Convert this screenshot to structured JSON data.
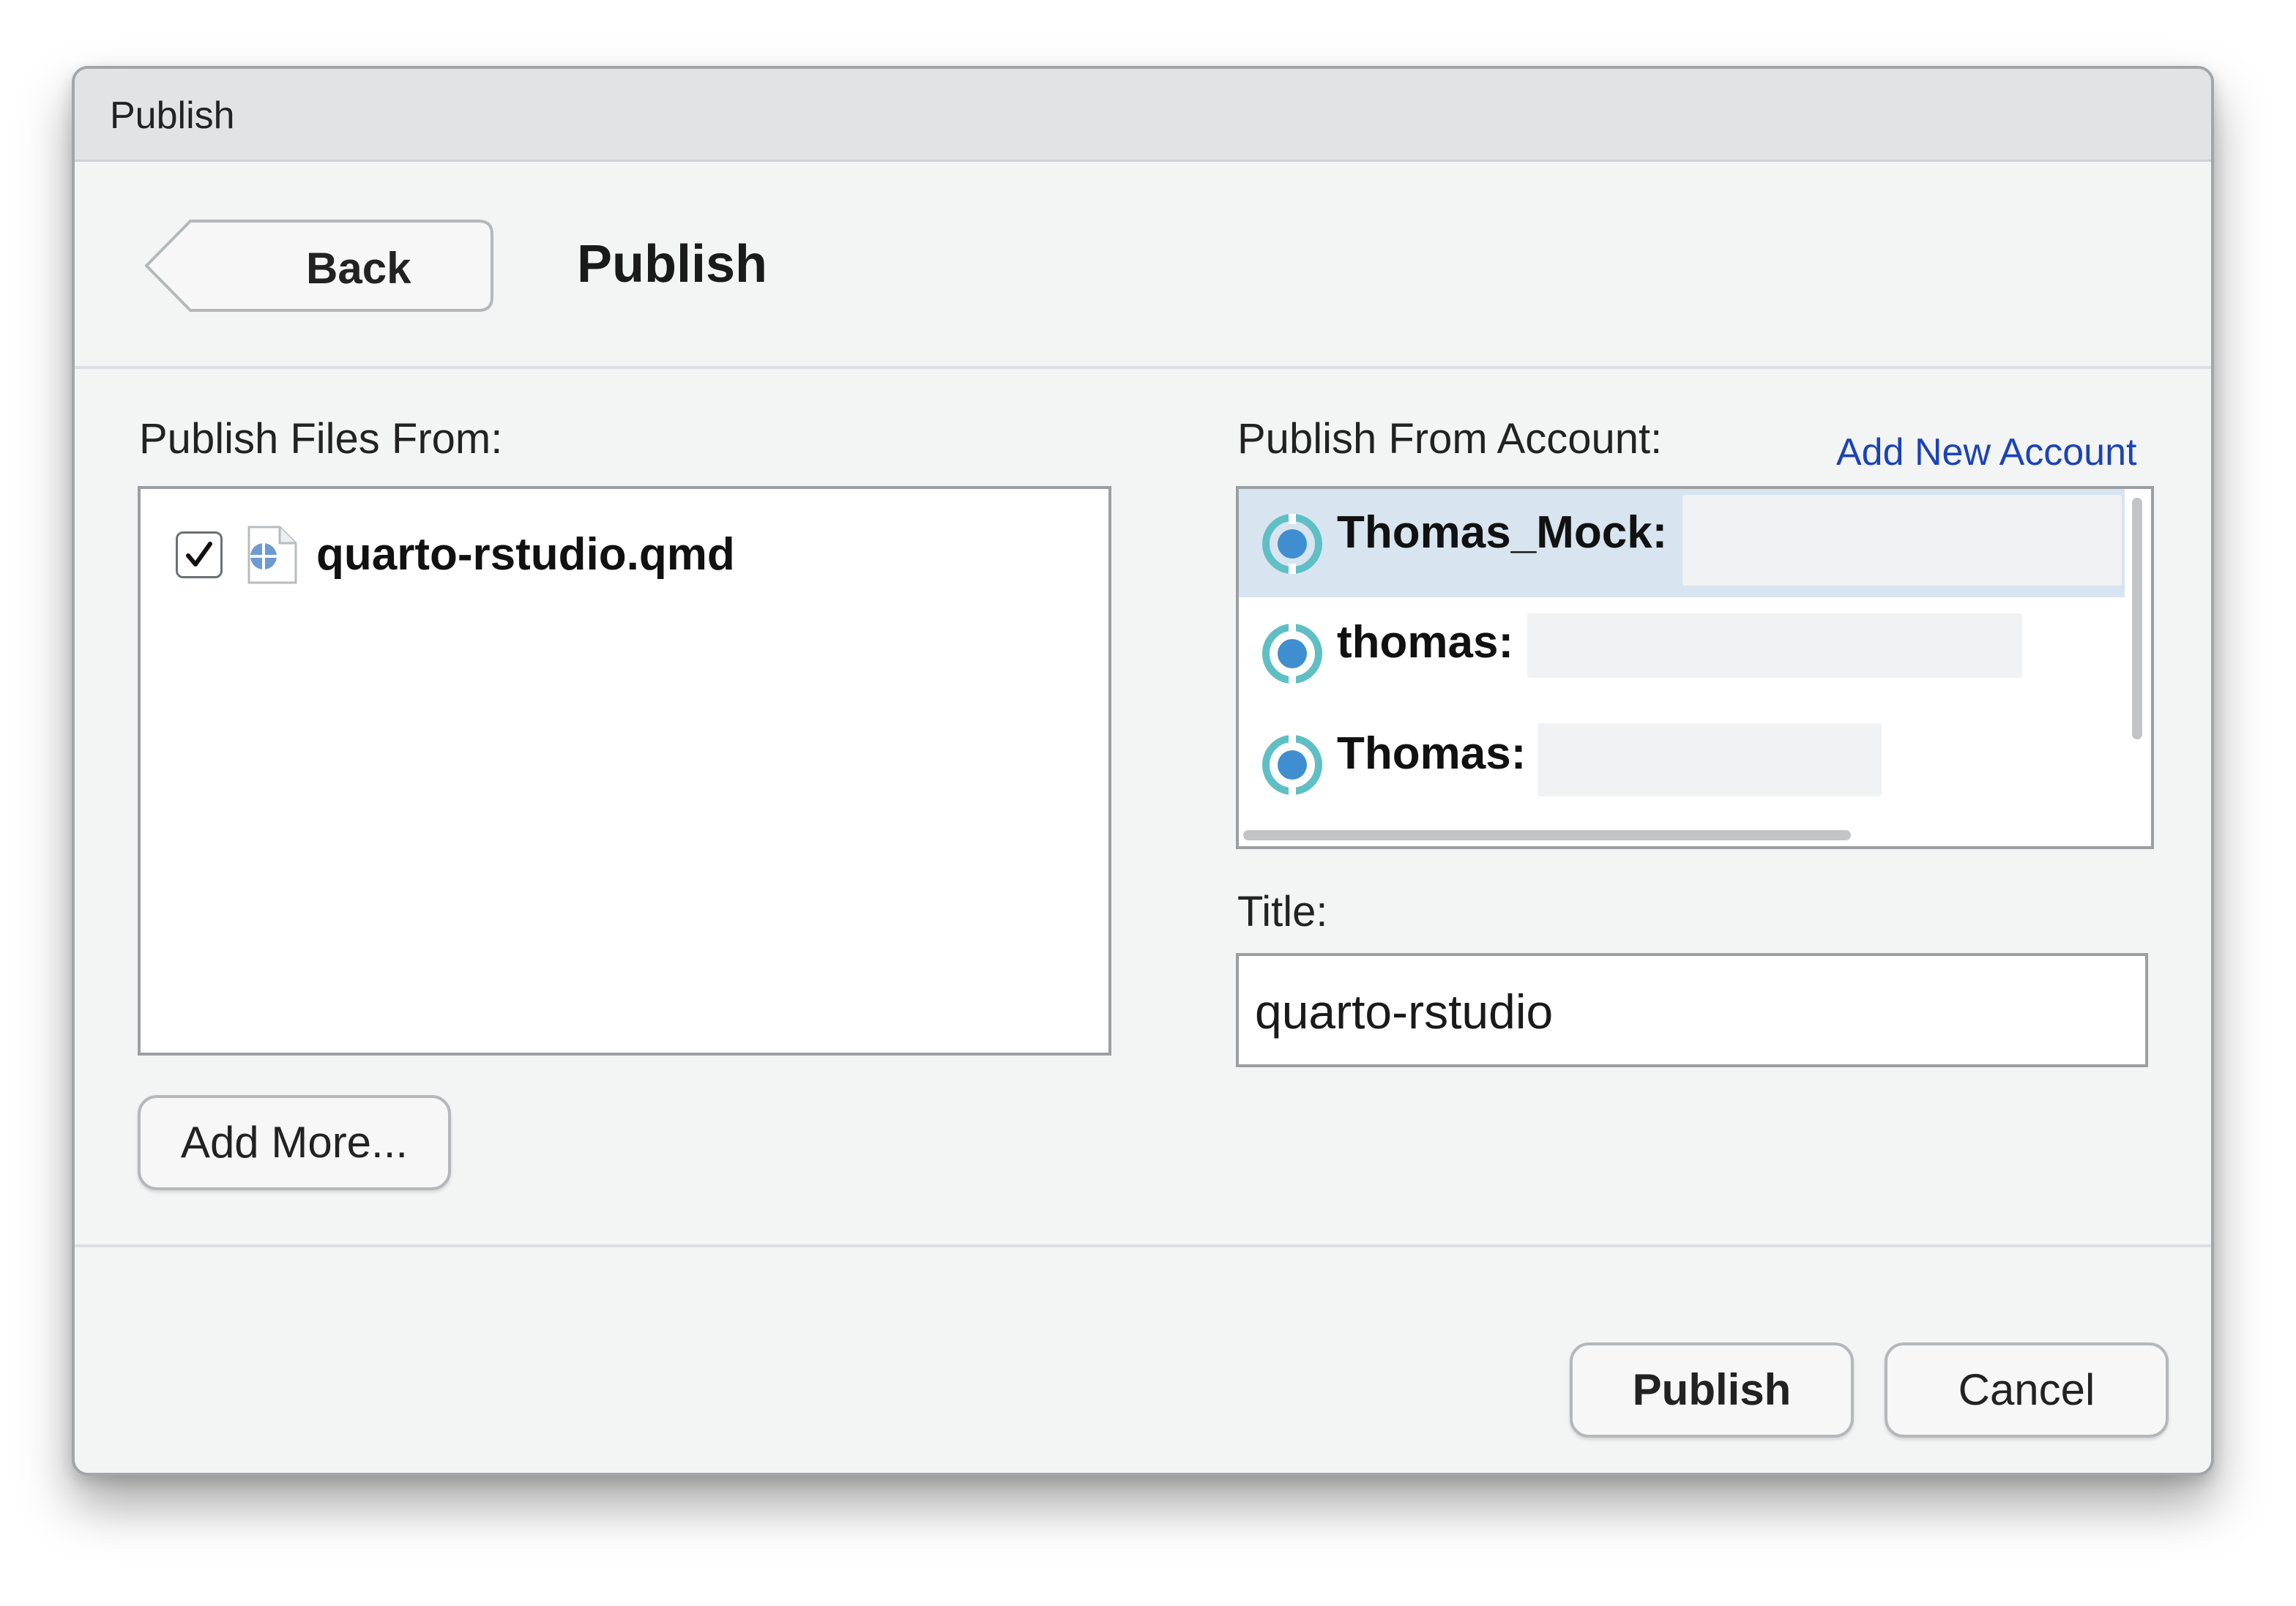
{
  "window": {
    "title": "Publish"
  },
  "header": {
    "back_label": "Back",
    "title": "Publish"
  },
  "files": {
    "label": "Publish Files From:",
    "items": [
      {
        "name": "quarto-rstudio.qmd",
        "checked": true
      }
    ],
    "add_more_label": "Add More..."
  },
  "accounts": {
    "label": "Publish From Account:",
    "add_new_label": "Add New Account",
    "items": [
      {
        "name": "Thomas_Mock:",
        "selected": true
      },
      {
        "name": "thomas:",
        "selected": false
      },
      {
        "name": "Thomas:",
        "selected": false
      }
    ]
  },
  "title_field": {
    "label": "Title:",
    "value": "quarto-rstudio"
  },
  "footer": {
    "publish_label": "Publish",
    "cancel_label": "Cancel"
  },
  "colors": {
    "link": "#1b43b8",
    "selection": "#d8e4ef",
    "icon_teal": "#5fbfc5",
    "icon_blue": "#3f8ed0"
  }
}
